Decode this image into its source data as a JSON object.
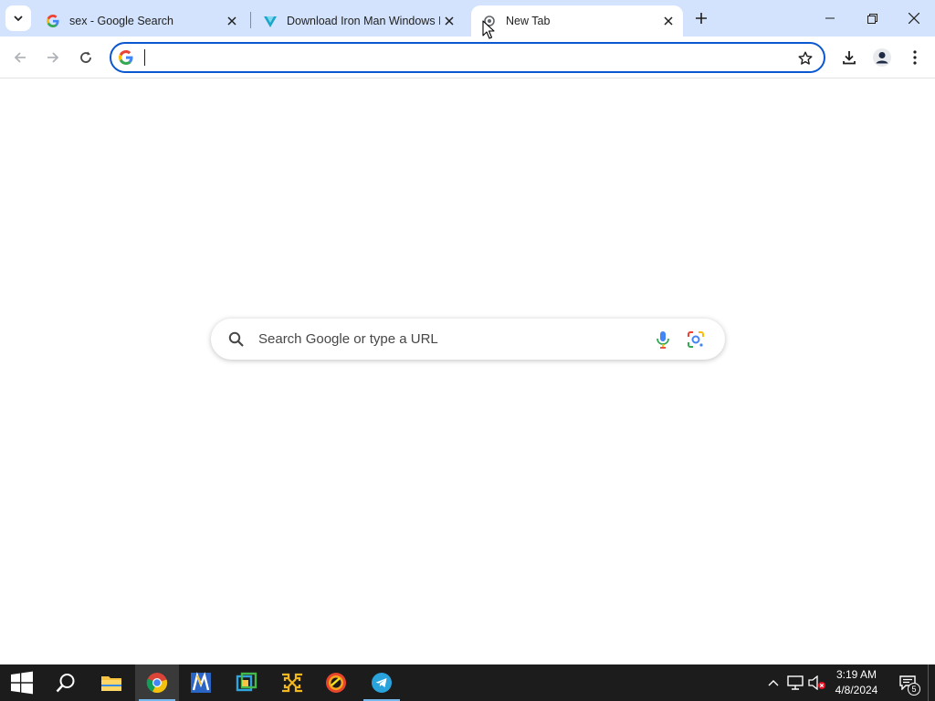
{
  "browser": {
    "tabs": [
      {
        "title": "sex - Google Search",
        "favicon": "google-g-icon",
        "active": false
      },
      {
        "title": "Download Iron Man Windows I",
        "favicon": "download-site-icon",
        "active": false
      },
      {
        "title": "New Tab",
        "favicon": "chrome-newtab-icon",
        "active": true
      }
    ],
    "omnibox": {
      "value": "",
      "placeholder": ""
    },
    "colors": {
      "tabstrip": "#d3e3fd",
      "accent": "#0b57d0"
    }
  },
  "ntp": {
    "search_placeholder": "Search Google or type a URL"
  },
  "taskbar": {
    "apps": [
      "start-icon",
      "search-icon",
      "file-explorer-icon",
      "chrome-icon",
      "app-m-icon",
      "app-green-icon",
      "app-yellow-icon",
      "app-orange-icon",
      "telegram-icon"
    ],
    "clock": {
      "time": "3:19 AM",
      "date": "4/8/2024"
    },
    "notification_count": "5"
  }
}
